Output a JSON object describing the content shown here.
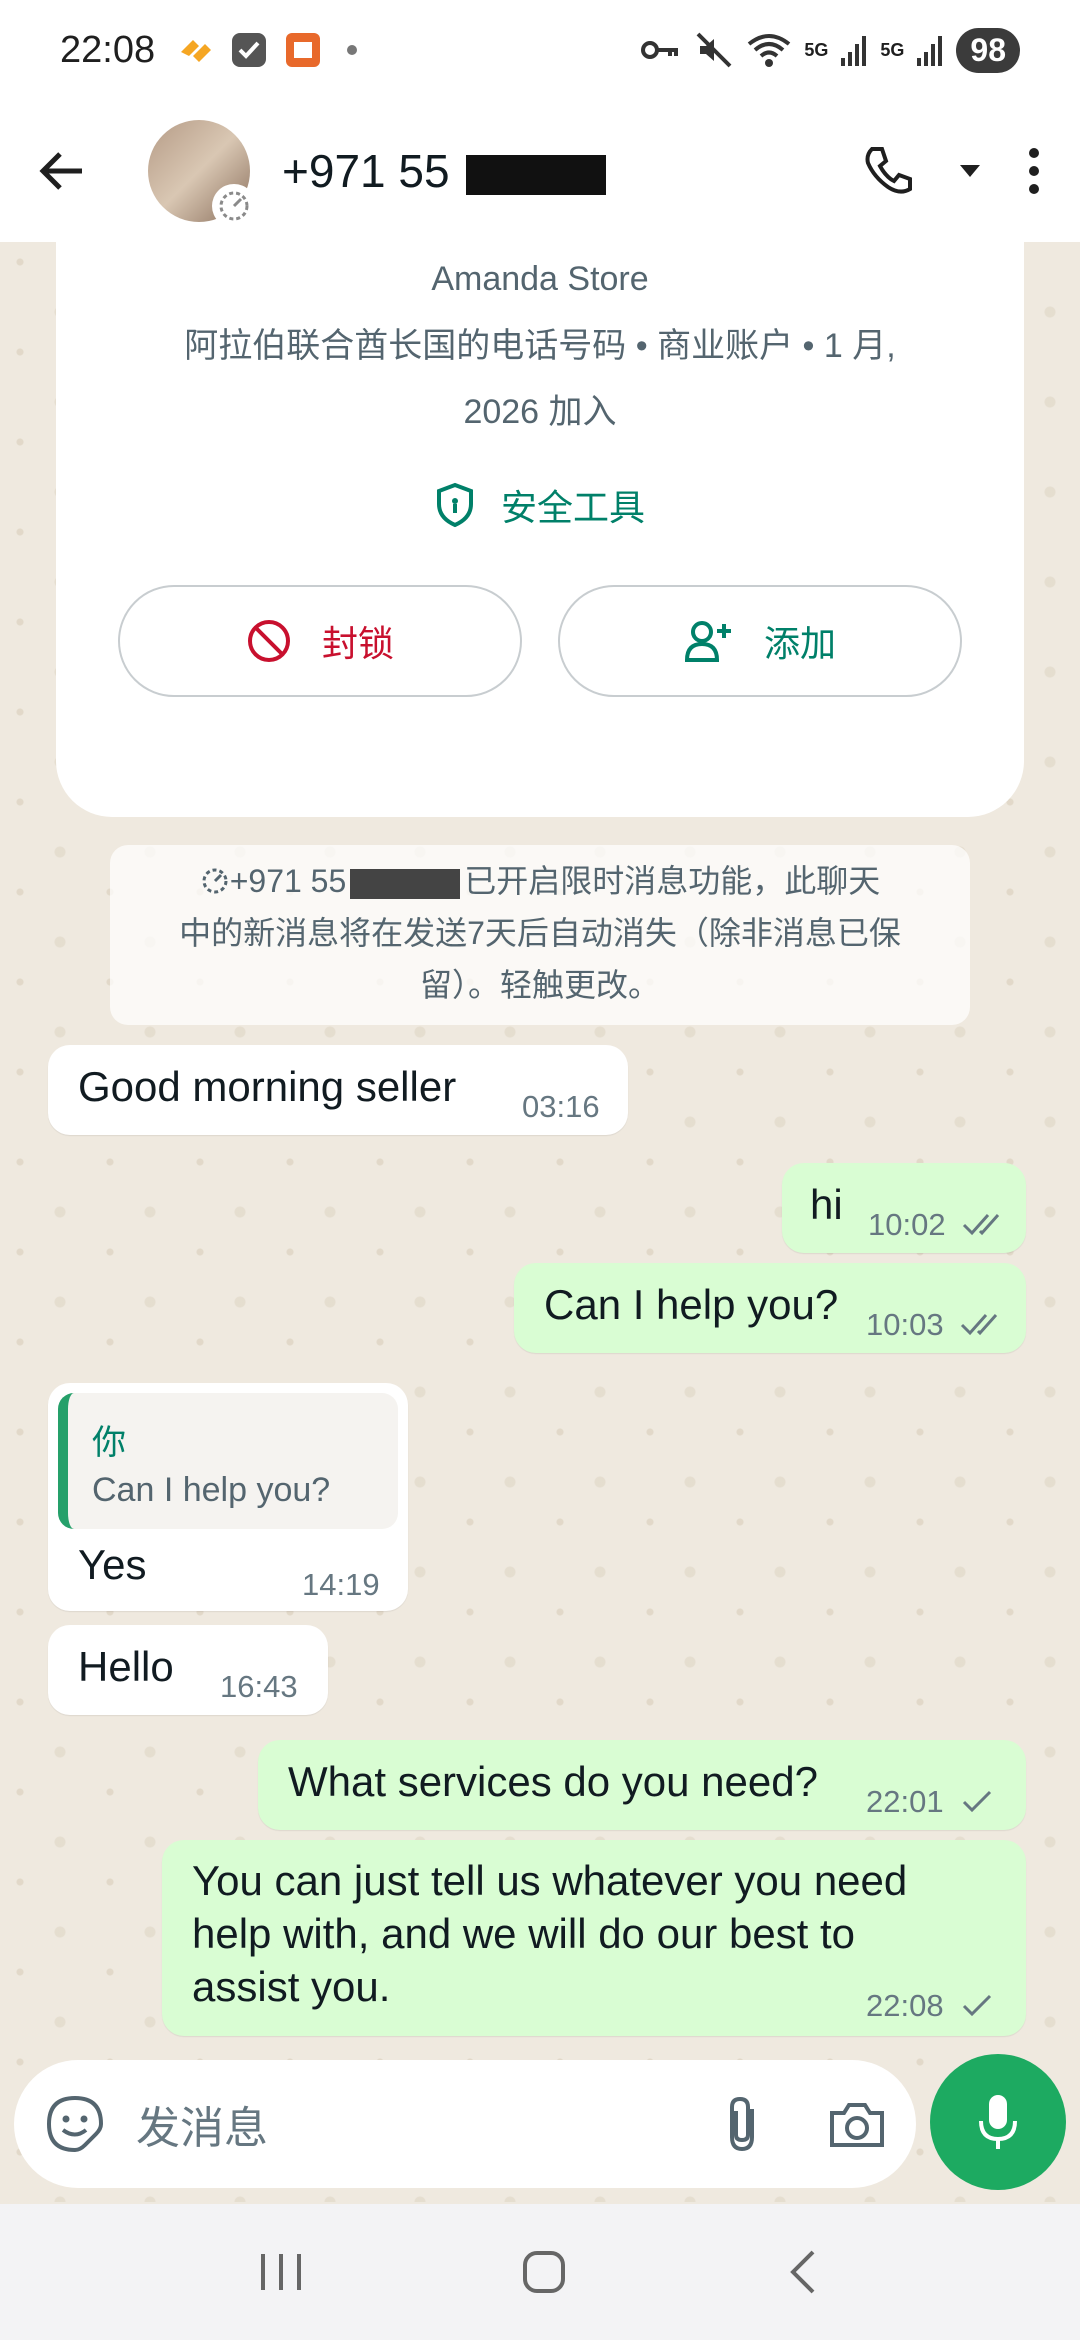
{
  "status_bar": {
    "time": "22:08",
    "battery": "98",
    "net_labels": [
      "5G",
      "5G"
    ]
  },
  "header": {
    "contact_title": "+971 55",
    "icons": [
      "back-arrow-icon",
      "phone-icon",
      "caret-down-icon",
      "more-vert-icon"
    ]
  },
  "info_card": {
    "store_name": "Amanda Store",
    "meta_line1": "阿拉伯联合酋长国的电话号码 • 商业账户 • 1 月,",
    "meta_line2": "2026 加入",
    "safety_tools": "安全工具",
    "block_label": "封锁",
    "add_label": "添加"
  },
  "system_note": {
    "line1_prefix": "+971 55",
    "line1_suffix": "已开启限时消息功能，此聊天",
    "line2": "中的新消息将在发送7天后自动消失（除非消息已保",
    "line3": "留）。轻触更改。"
  },
  "messages": [
    {
      "dir": "in",
      "text": "Good morning seller",
      "time": "03:16"
    },
    {
      "dir": "out",
      "text": "hi",
      "time": "10:02",
      "ticks": "double"
    },
    {
      "dir": "out",
      "text": "Can I help you?",
      "time": "10:03",
      "ticks": "double"
    },
    {
      "dir": "in",
      "quote_author": "你",
      "quote_text": "Can I help you?",
      "text": "Yes",
      "time": "14:19"
    },
    {
      "dir": "in",
      "text": "Hello",
      "time": "16:43"
    },
    {
      "dir": "out",
      "text": "What services do you need?",
      "time": "22:01",
      "ticks": "single"
    },
    {
      "dir": "out",
      "text_lines": [
        "You can just tell us whatever you need",
        "help with, and we will do our best to",
        "assist you."
      ],
      "time": "22:08",
      "ticks": "single"
    }
  ],
  "composer": {
    "placeholder": "发消息"
  },
  "colors": {
    "accent": "#008069",
    "mic_bg": "#1daa61",
    "out_bubble": "#d9fdd3",
    "block_red": "#c8102e"
  }
}
